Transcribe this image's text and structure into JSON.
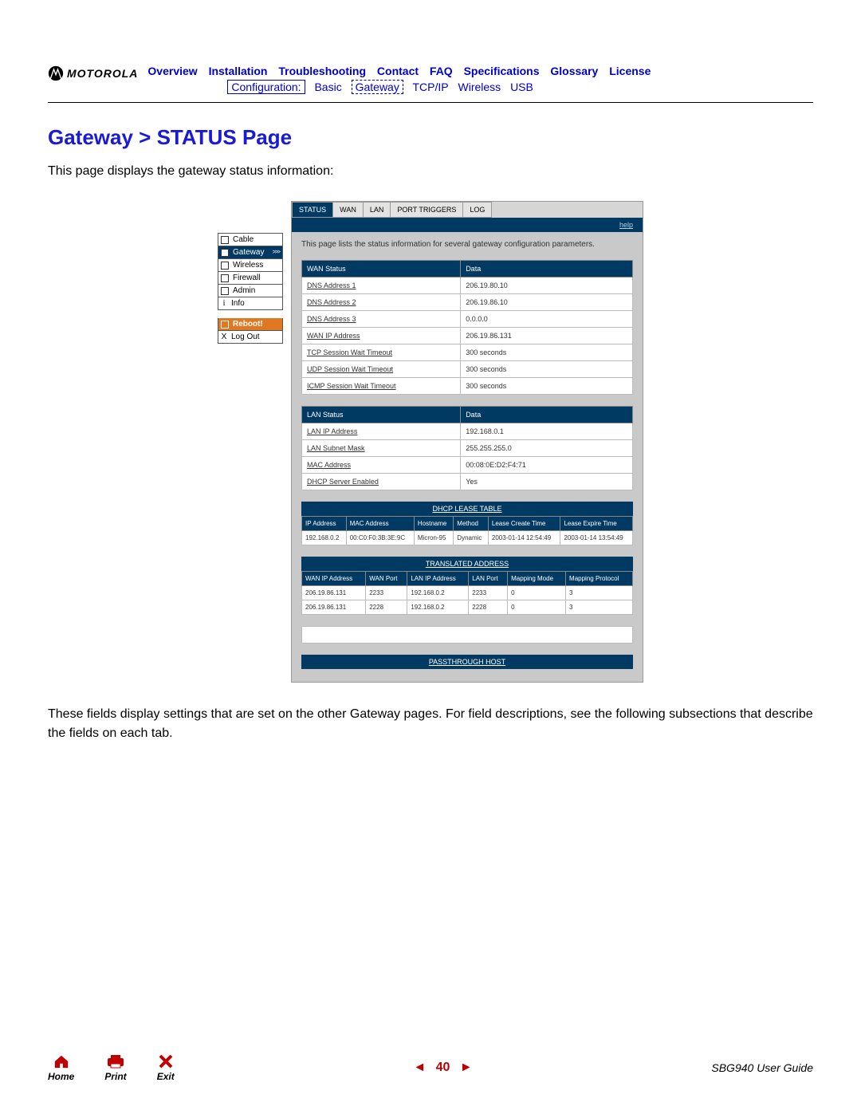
{
  "brand": "MOTOROLA",
  "nav": {
    "items": [
      "Overview",
      "Installation",
      "Troubleshooting",
      "Contact",
      "FAQ",
      "Specifications",
      "Glossary",
      "License"
    ]
  },
  "subnav": {
    "active": "Configuration:",
    "items": [
      "Basic",
      "Gateway",
      "TCP/IP",
      "Wireless",
      "USB"
    ],
    "dashed_index": 1
  },
  "title": "Gateway > STATUS Page",
  "intro": "This page displays the gateway status information:",
  "sidenav": {
    "items": [
      "Cable",
      "Gateway",
      "Wireless",
      "Firewall",
      "Admin"
    ],
    "active_index": 1,
    "info": "Info",
    "reboot": "Reboot!",
    "logout": "Log Out"
  },
  "tabs": {
    "items": [
      "STATUS",
      "WAN",
      "LAN",
      "PORT TRIGGERS",
      "LOG"
    ],
    "active_index": 0
  },
  "help_label": "help",
  "panel_desc": "This page lists the status information for several gateway configuration parameters.",
  "wan": {
    "headers": [
      "WAN Status",
      "Data"
    ],
    "rows": [
      {
        "label": "DNS Address 1",
        "value": "206.19.80.10"
      },
      {
        "label": "DNS Address 2",
        "value": "206.19.86.10"
      },
      {
        "label": "DNS Address 3",
        "value": "0.0.0.0"
      },
      {
        "label": "WAN IP Address",
        "value": "206.19.86.131"
      },
      {
        "label": "TCP Session Wait Timeout",
        "value": "300 seconds"
      },
      {
        "label": "UDP Session Wait Timeout",
        "value": "300 seconds"
      },
      {
        "label": "ICMP Session Wait Timeout",
        "value": "300 seconds"
      }
    ]
  },
  "lan": {
    "headers": [
      "LAN Status",
      "Data"
    ],
    "rows": [
      {
        "label": "LAN IP Address",
        "value": "192.168.0.1"
      },
      {
        "label": "LAN Subnet Mask",
        "value": "255.255.255.0"
      },
      {
        "label": "MAC Address",
        "value": "00:08:0E:D2:F4:71"
      },
      {
        "label": "DHCP Server Enabled",
        "value": "Yes"
      }
    ]
  },
  "dhcp": {
    "caption": "DHCP LEASE TABLE",
    "headers": [
      "IP Address",
      "MAC Address",
      "Hostname",
      "Method",
      "Lease Create Time",
      "Lease Expire Time"
    ],
    "rows": [
      {
        "c": [
          "192.168.0.2",
          "00:C0:F0:3B:3E:9C",
          "Micron-95",
          "Dynamic",
          "2003-01-14 12:54:49",
          "2003-01-14 13:54:49"
        ]
      }
    ]
  },
  "trans": {
    "caption": "TRANSLATED ADDRESS",
    "headers": [
      "WAN IP Address",
      "WAN Port",
      "LAN IP Address",
      "LAN Port",
      "Mapping Mode",
      "Mapping Protocol"
    ],
    "rows": [
      {
        "c": [
          "206.19.86.131",
          "2233",
          "192.168.0.2",
          "2233",
          "0",
          "3"
        ]
      },
      {
        "c": [
          "206.19.86.131",
          "2228",
          "192.168.0.2",
          "2228",
          "0",
          "3"
        ]
      }
    ]
  },
  "pass": {
    "caption": "PASSTHROUGH HOST"
  },
  "outro": "These fields display settings that are set on the other Gateway pages. For field descriptions, see the following subsections that describe the fields on each tab.",
  "footer": {
    "home": "Home",
    "print": "Print",
    "exit": "Exit",
    "page": "40",
    "guide": "SBG940 User Guide"
  }
}
